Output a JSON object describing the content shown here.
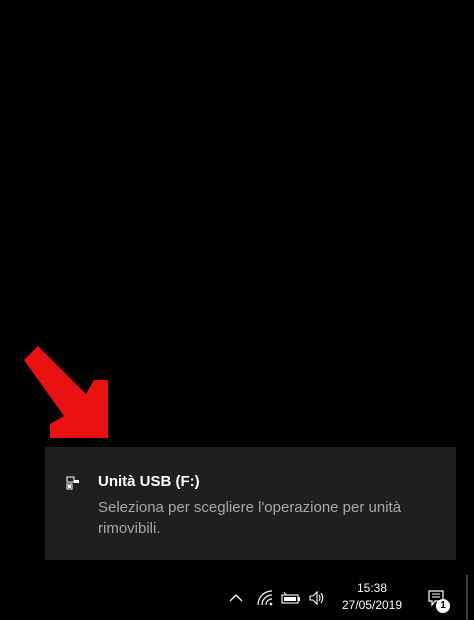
{
  "toast": {
    "title": "Unità USB (F:)",
    "body": "Seleziona per scegliere l'operazione per unità rimovibili.",
    "icon": "usb-drive-icon"
  },
  "taskbar": {
    "clock_time": "15:38",
    "clock_date": "27/05/2019",
    "tray_icons": [
      "chevron-up-icon",
      "wifi-icon",
      "battery-icon",
      "volume-icon"
    ],
    "notification_count": "1"
  },
  "colors": {
    "background": "#000000",
    "toast_background": "#1f1f1f",
    "arrow": "#e81010",
    "title_text": "#ffffff",
    "body_text": "#a8a8a8"
  }
}
